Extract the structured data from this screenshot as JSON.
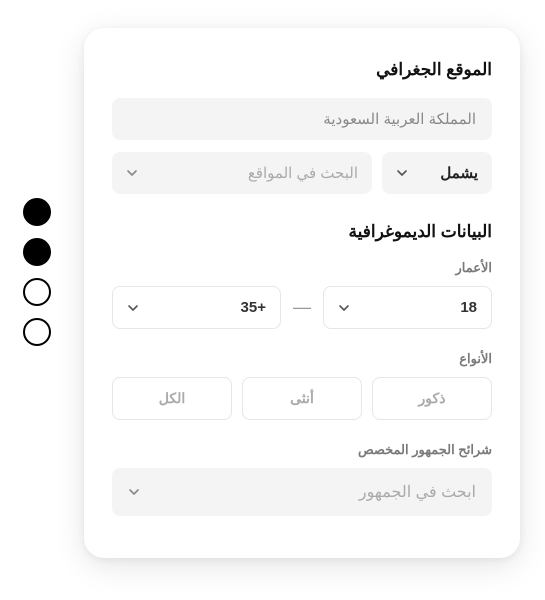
{
  "location": {
    "title": "الموقع الجغرافي",
    "country": "المملكة العربية السعودية",
    "include_label": "يشمل",
    "search_placeholder": "البحث في المواقع"
  },
  "demographics": {
    "title": "البيانات الديموغرافية",
    "ages": {
      "label": "الأعمار",
      "min": "18",
      "max": "+35",
      "separator": "—"
    },
    "genders": {
      "label": "الأنواع",
      "male": "ذكور",
      "female": "أنثى",
      "all": "الكل"
    },
    "audience": {
      "label": "شرائح الجمهور المخصص",
      "placeholder": "ابحث في الجمهور"
    }
  }
}
